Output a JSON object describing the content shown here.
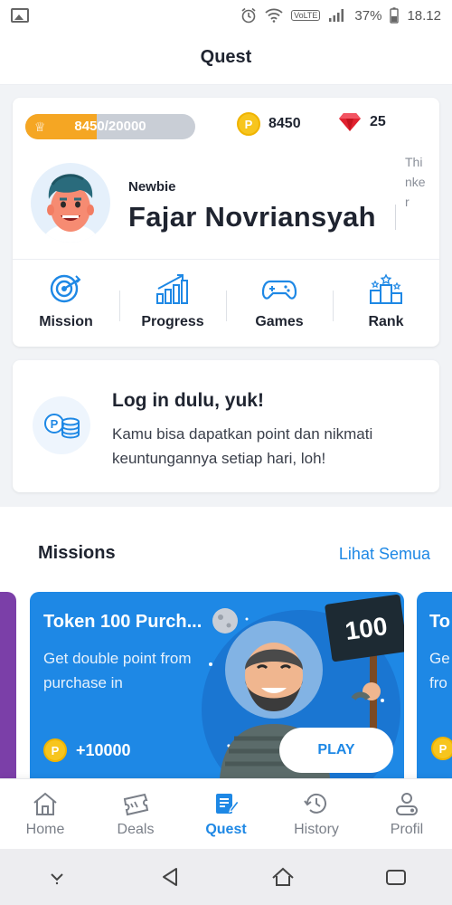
{
  "status_bar": {
    "battery": "37%",
    "time": "18.12",
    "network": "VoLTE"
  },
  "header": {
    "title": "Quest"
  },
  "profile": {
    "xp_text": "8450/20000",
    "xp_fraction": 0.4225,
    "points": "8450",
    "gems": "25",
    "coin_symbol": "P",
    "rank_label": "Newbie",
    "user_name": "Fajar Novriansyah",
    "user_title": "Thinker",
    "menu": [
      {
        "label": "Mission",
        "icon": "target-icon"
      },
      {
        "label": "Progress",
        "icon": "bar-chart-icon"
      },
      {
        "label": "Games",
        "icon": "gamepad-icon"
      },
      {
        "label": "Rank",
        "icon": "podium-icon"
      }
    ]
  },
  "login_card": {
    "title": "Log in dulu, yuk!",
    "description": "Kamu bisa dapatkan point dan nikmati keuntungannya setiap hari, loh!"
  },
  "missions": {
    "section_title": "Missions",
    "see_all": "Lihat Semua",
    "cards": [
      {
        "title": "Token 100 Purch...",
        "description": "Get double point from purchase in",
        "reward": "+10000",
        "button": "PLAY",
        "sign_text": "100"
      },
      {
        "title": "To",
        "description": "Ge fro"
      }
    ]
  },
  "bottom_nav": [
    {
      "label": "Home",
      "icon": "home-icon",
      "active": false
    },
    {
      "label": "Deals",
      "icon": "ticket-icon",
      "active": false
    },
    {
      "label": "Quest",
      "icon": "quest-icon",
      "active": true
    },
    {
      "label": "History",
      "icon": "history-icon",
      "active": false
    },
    {
      "label": "Profil",
      "icon": "profile-icon",
      "active": false
    }
  ],
  "colors": {
    "accent": "#1e88e5",
    "xp_fill": "#f5a623",
    "coin": "#f7c51e",
    "gem": "#e0212f"
  }
}
